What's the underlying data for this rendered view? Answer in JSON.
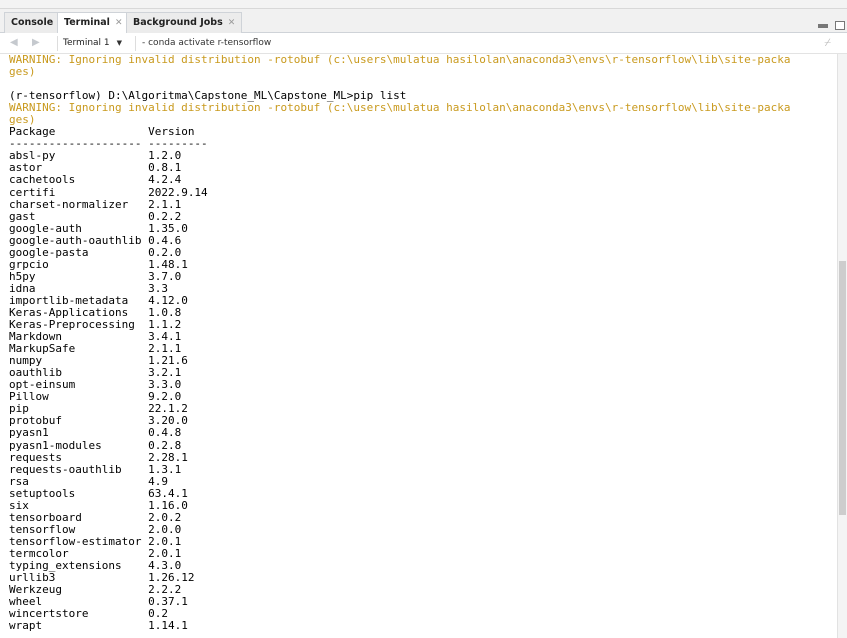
{
  "tabs": [
    {
      "label": "Console",
      "closable": false,
      "active": false
    },
    {
      "label": "Terminal",
      "closable": true,
      "active": true
    },
    {
      "label": "Background Jobs",
      "closable": true,
      "active": false
    }
  ],
  "toolbar": {
    "terminal_selector": "Terminal 1",
    "terminal_title": "- conda activate r-tensorflow"
  },
  "terminal": {
    "warning_lines": [
      "WARNING: Ignoring invalid distribution -rotobuf (c:\\users\\mulatua hasilolan\\anaconda3\\envs\\r-tensorflow\\lib\\site-packa",
      "ges)"
    ],
    "prompt_command": "(r-tensorflow) D:\\Algoritma\\Capstone_ML\\Capstone_ML>pip list",
    "header": {
      "package": "Package",
      "version": "Version"
    },
    "separator_package": "--------------------",
    "separator_version": "---------",
    "packages": [
      {
        "name": "absl-py",
        "version": "1.2.0"
      },
      {
        "name": "astor",
        "version": "0.8.1"
      },
      {
        "name": "cachetools",
        "version": "4.2.4"
      },
      {
        "name": "certifi",
        "version": "2022.9.14"
      },
      {
        "name": "charset-normalizer",
        "version": "2.1.1"
      },
      {
        "name": "gast",
        "version": "0.2.2"
      },
      {
        "name": "google-auth",
        "version": "1.35.0"
      },
      {
        "name": "google-auth-oauthlib",
        "version": "0.4.6"
      },
      {
        "name": "google-pasta",
        "version": "0.2.0"
      },
      {
        "name": "grpcio",
        "version": "1.48.1"
      },
      {
        "name": "h5py",
        "version": "3.7.0"
      },
      {
        "name": "idna",
        "version": "3.3"
      },
      {
        "name": "importlib-metadata",
        "version": "4.12.0"
      },
      {
        "name": "Keras-Applications",
        "version": "1.0.8"
      },
      {
        "name": "Keras-Preprocessing",
        "version": "1.1.2"
      },
      {
        "name": "Markdown",
        "version": "3.4.1"
      },
      {
        "name": "MarkupSafe",
        "version": "2.1.1"
      },
      {
        "name": "numpy",
        "version": "1.21.6"
      },
      {
        "name": "oauthlib",
        "version": "3.2.1"
      },
      {
        "name": "opt-einsum",
        "version": "3.3.0"
      },
      {
        "name": "Pillow",
        "version": "9.2.0"
      },
      {
        "name": "pip",
        "version": "22.1.2"
      },
      {
        "name": "protobuf",
        "version": "3.20.0"
      },
      {
        "name": "pyasn1",
        "version": "0.4.8"
      },
      {
        "name": "pyasn1-modules",
        "version": "0.2.8"
      },
      {
        "name": "requests",
        "version": "2.28.1"
      },
      {
        "name": "requests-oauthlib",
        "version": "1.3.1"
      },
      {
        "name": "rsa",
        "version": "4.9"
      },
      {
        "name": "setuptools",
        "version": "63.4.1"
      },
      {
        "name": "six",
        "version": "1.16.0"
      },
      {
        "name": "tensorboard",
        "version": "2.0.2"
      },
      {
        "name": "tensorflow",
        "version": "2.0.0"
      },
      {
        "name": "tensorflow-estimator",
        "version": "2.0.1"
      },
      {
        "name": "termcolor",
        "version": "2.0.1"
      },
      {
        "name": "typing_extensions",
        "version": "4.3.0"
      },
      {
        "name": "urllib3",
        "version": "1.26.12"
      },
      {
        "name": "Werkzeug",
        "version": "2.2.2"
      },
      {
        "name": "wheel",
        "version": "0.37.1"
      },
      {
        "name": "wincertstore",
        "version": "0.2"
      },
      {
        "name": "wrapt",
        "version": "1.14.1"
      }
    ]
  },
  "colors": {
    "warning": "#c99a1e",
    "text": "#000000",
    "background": "#ffffff"
  },
  "icons": {
    "back": "arrow-left-icon",
    "forward": "arrow-right-icon",
    "clear": "broom-icon",
    "minimize": "minimize-icon",
    "maximize": "maximize-icon"
  }
}
